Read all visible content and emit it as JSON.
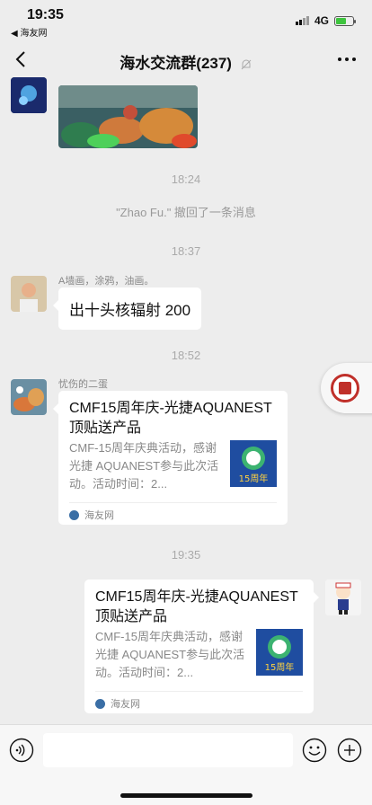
{
  "status_bar": {
    "time": "19:35",
    "back_app": "◀ 海友网",
    "network": "4G",
    "battery_level": 0.6
  },
  "nav": {
    "title": "海水交流群(237)",
    "back_icon": "chevron-left-icon",
    "more_icon": "more-dots-icon",
    "mute_icon": "bell-slash-icon"
  },
  "messages": [
    {
      "type": "image",
      "sender": "",
      "side": "left"
    },
    {
      "type": "timestamp",
      "text": "18:24"
    },
    {
      "type": "system",
      "text": "\"Zhao Fu.\" 撤回了一条消息"
    },
    {
      "type": "timestamp",
      "text": "18:37"
    },
    {
      "type": "text",
      "sender": "A墙画，涂鸦，油画。",
      "text": "出十头核辐射 200",
      "side": "left"
    },
    {
      "type": "timestamp",
      "text": "18:52"
    },
    {
      "type": "card",
      "sender": "忧伤的二蛋",
      "side": "left",
      "title": "CMF15周年庆-光捷AQUANEST顶贴送产品",
      "desc": "CMF-15周年庆典活动，感谢光捷 AQUANEST参与此次活动。活动时间：2...",
      "source": "海友网",
      "thumb_label": "15周年"
    },
    {
      "type": "timestamp",
      "text": "19:35"
    },
    {
      "type": "card",
      "sender": "",
      "side": "right",
      "title": "CMF15周年庆-光捷AQUANEST顶贴送产品",
      "desc": "CMF-15周年庆典活动，感谢光捷 AQUANEST参与此次活动。活动时间：2...",
      "source": "海友网",
      "thumb_label": "15周年"
    }
  ],
  "input_bar": {
    "voice_icon": "voice-icon",
    "emoji_icon": "emoji-icon",
    "plus_icon": "plus-circle-icon",
    "input_value": ""
  },
  "colors": {
    "background": "#ededed",
    "bubble": "#ffffff",
    "accent_green": "#3ec43e"
  }
}
